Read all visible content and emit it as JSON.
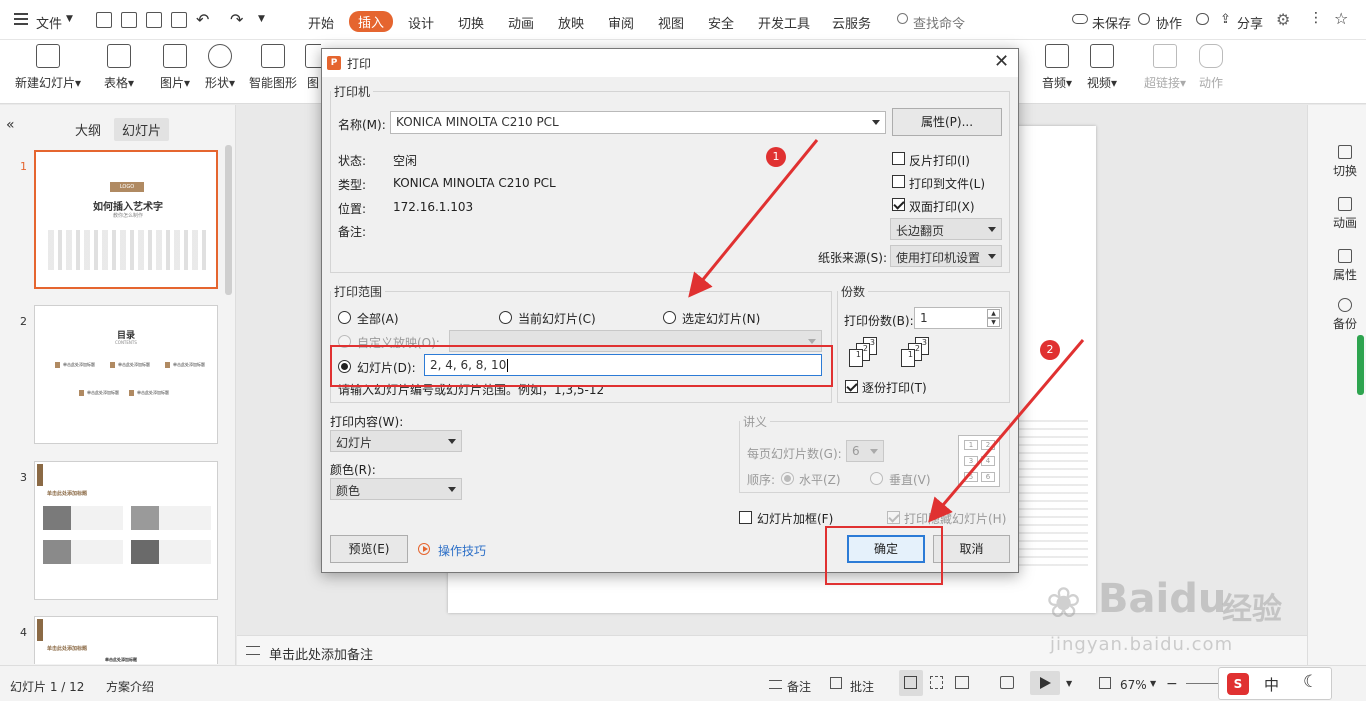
{
  "menubar": {
    "file": "文件",
    "tabs": [
      "开始",
      "插入",
      "设计",
      "切换",
      "动画",
      "放映",
      "审阅",
      "视图",
      "安全",
      "开发工具",
      "云服务"
    ],
    "active_tab": "插入",
    "search": "查找命令",
    "unsaved": "未保存",
    "collab": "协作",
    "share": "分享"
  },
  "ribbon": {
    "new_slide": "新建幻灯片",
    "table": "表格",
    "picture": "图片",
    "shape": "形状",
    "smartart": "智能图形",
    "chart_partial": "图",
    "audio": "音频",
    "video": "视频",
    "hyperlink": "超链接",
    "action": "动作"
  },
  "left_panel": {
    "tab_outline": "大纲",
    "tab_slides": "幻灯片",
    "slides": [
      {
        "num": "1",
        "title": "如何插入艺术字",
        "badge": "LOGO",
        "sub": "教你怎么制作"
      },
      {
        "num": "2",
        "title": "目录",
        "sub": "CONTENTS",
        "items": [
          "单击此处添加标题",
          "单击此处添加标题",
          "单击此处添加标题",
          "单击此处添加标题",
          "单击此处添加标题"
        ]
      },
      {
        "num": "3",
        "title": "单击此处添加标题"
      },
      {
        "num": "4",
        "title": "单击此处添加标题",
        "sub": "单击此处添加标题"
      }
    ]
  },
  "notes_placeholder": "单击此处添加备注",
  "right_sidebar": [
    "切换",
    "动画",
    "属性",
    "备份"
  ],
  "statusbar": {
    "slide_indicator": "幻灯片 1 / 12",
    "theme": "方案介绍",
    "notes": "备注",
    "comments": "批注",
    "zoom": "67%",
    "ime": "中"
  },
  "dialog": {
    "title": "打印",
    "printer_group": "打印机",
    "name_label": "名称(M):",
    "printer_name": "KONICA MINOLTA C210 PCL",
    "properties_btn": "属性(P)...",
    "status_label": "状态:",
    "status_value": "空闲",
    "type_label": "类型:",
    "type_value": "KONICA MINOLTA C210 PCL",
    "location_label": "位置:",
    "location_value": "172.16.1.103",
    "comment_label": "备注:",
    "reverse_print": "反片打印(I)",
    "print_to_file": "打印到文件(L)",
    "duplex": "双面打印(X)",
    "duplex_mode": "长边翻页",
    "paper_source_label": "纸张来源(S):",
    "paper_source": "使用打印机设置",
    "range_group": "打印范围",
    "all": "全部(A)",
    "current_slide": "当前幻灯片(C)",
    "selected_slides": "选定幻灯片(N)",
    "custom_show": "自定义放映(O):",
    "slides_label": "幻灯片(D):",
    "slides_value": "2, 4, 6, 8, 10",
    "hint": "请输入幻灯片编号或幻灯片范围。例如，1,3,5-12",
    "copies_group": "份数",
    "copies_label": "打印份数(B):",
    "copies_value": "1",
    "collate": "逐份打印(T)",
    "print_what_label": "打印内容(W):",
    "print_what": "幻灯片",
    "color_label": "颜色(R):",
    "color_value": "颜色",
    "handouts_group": "讲义",
    "per_page_label": "每页幻灯片数(G):",
    "per_page_value": "6",
    "order_label": "顺序:",
    "horizontal": "水平(Z)",
    "vertical": "垂直(V)",
    "frame_slides": "幻灯片加框(F)",
    "print_hidden": "打印隐藏幻灯片(H)",
    "preview_btn": "预览(E)",
    "tips_link": "操作技巧",
    "ok_btn": "确定",
    "cancel_btn": "取消"
  },
  "annotations": {
    "step1": "1",
    "step2": "2"
  },
  "watermark": {
    "brand": "Baidu",
    "brand_cn": "经验",
    "url": "jingyan.baidu.com"
  },
  "colors": {
    "accent": "#e5652f",
    "annotation_red": "#e03131",
    "focus_blue": "#2c7bd6"
  }
}
